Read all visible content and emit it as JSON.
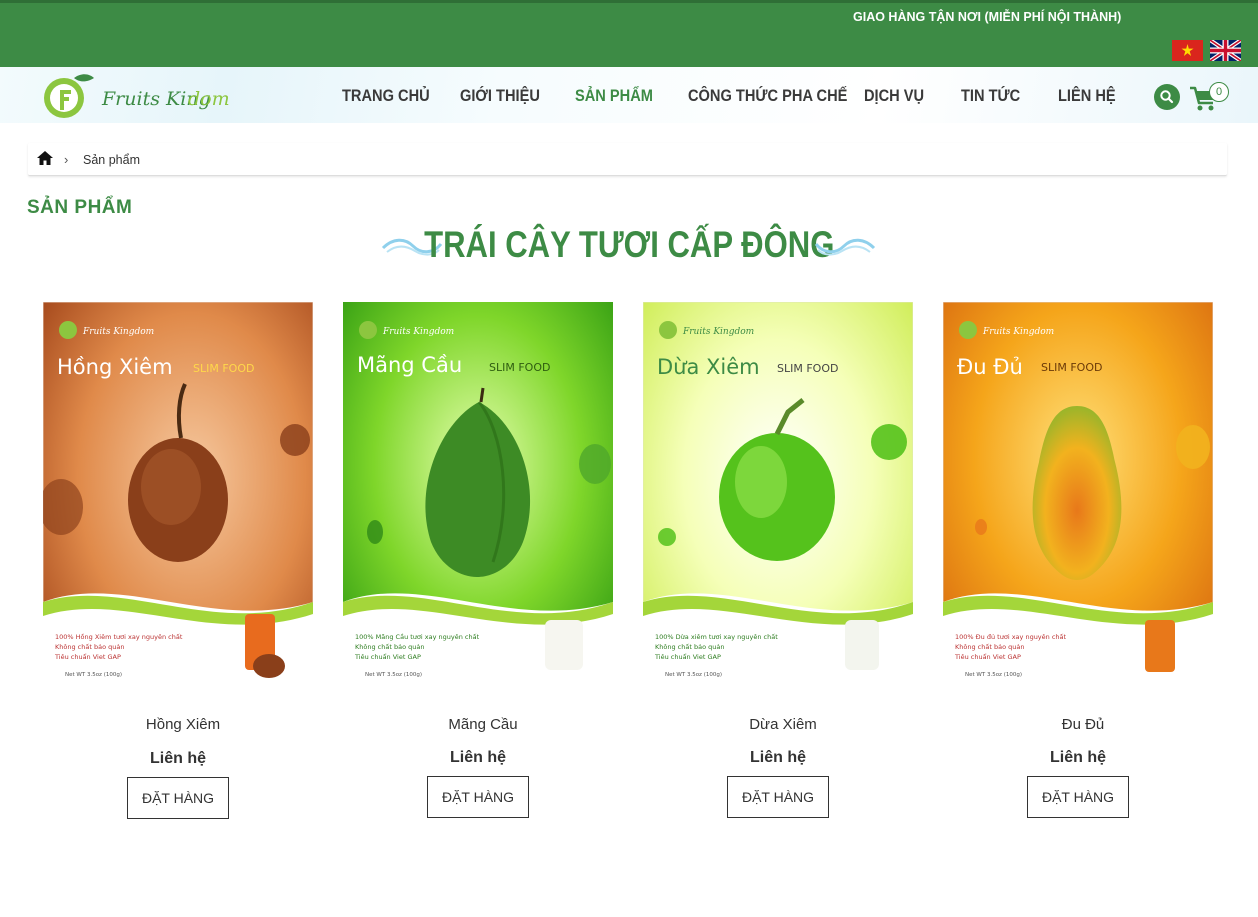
{
  "topbar": {
    "shipping_text": "GIAO HÀNG TẬN NƠI (MIỄN PHÍ NỘI THÀNH)",
    "color": "#3d8b45"
  },
  "logo": {
    "text_part1": "Fruits King",
    "text_part2": "dom"
  },
  "nav": {
    "items": [
      {
        "label": "TRANG CHỦ",
        "active": false
      },
      {
        "label": "GIỚI THIỆU",
        "active": false
      },
      {
        "label": "SẢN PHẨM",
        "active": true
      },
      {
        "label": "CÔNG THỨC PHA CHẾ",
        "active": false
      },
      {
        "label": "DỊCH VỤ",
        "active": false
      },
      {
        "label": "TIN TỨC",
        "active": false
      },
      {
        "label": "LIÊN HỆ",
        "active": false
      }
    ],
    "cart_count": "0",
    "search_icon": "search-icon",
    "cart_icon": "cart-icon"
  },
  "breadcrumb": {
    "current": "Sản phẩm",
    "sep": "›"
  },
  "page_title": "SẢN PHẨM",
  "section_title": "TRÁI CÂY TƯƠI CẤP ĐÔNG",
  "products": [
    {
      "name": "Hồng Xiêm",
      "price": "Liên hệ",
      "button": "ĐẶT HÀNG",
      "pack_title": "Hồng Xiêm",
      "pack_subtitle": "SLIM FOOD",
      "bullets": [
        "100% Hồng Xiêm tươi xay nguyên chất",
        "Không chất bảo quản",
        "Tiêu chuẩn Viet GAP"
      ],
      "net": "Net WT 3.5oz (100g)"
    },
    {
      "name": "Mãng Cầu",
      "price": "Liên hệ",
      "button": "ĐẶT HÀNG",
      "pack_title": "Mãng Cầu",
      "pack_subtitle": "SLIM FOOD",
      "bullets": [
        "100% Mãng Cầu tươi xay nguyên chất",
        "Không chất bảo quản",
        "Tiêu chuẩn Viet GAP"
      ],
      "net": "Net WT 3.5oz (100g)"
    },
    {
      "name": "Dừa Xiêm",
      "price": "Liên hệ",
      "button": "ĐẶT HÀNG",
      "pack_title": "Dừa Xiêm",
      "pack_subtitle": "SLIM FOOD",
      "bullets": [
        "100% Dừa xiêm tươi xay nguyên chất",
        "Không chất bảo quản",
        "Tiêu chuẩn Viet GAP"
      ],
      "net": "Net WT 3.5oz (100g)"
    },
    {
      "name": "Đu Đủ",
      "price": "Liên hệ",
      "button": "ĐẶT HÀNG",
      "pack_title": "Đu Đủ",
      "pack_subtitle": "SLIM FOOD",
      "bullets": [
        "100% Đu đủ tươi xay nguyên chất",
        "Không chất bảo quản",
        "Tiêu chuẩn Viet GAP"
      ],
      "net": "Net WT 3.5oz (100g)"
    }
  ]
}
